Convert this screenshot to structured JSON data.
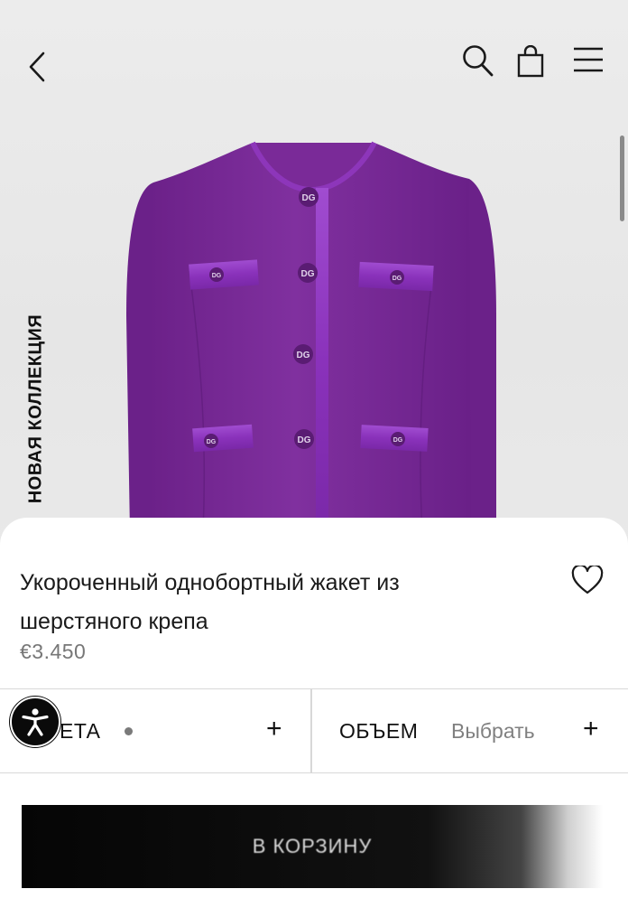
{
  "header": {
    "back_icon": "chevron-left-icon",
    "search_icon": "search-icon",
    "bag_icon": "shopping-bag-icon",
    "menu_icon": "hamburger-menu-icon"
  },
  "hero": {
    "collection_label": "НОВАЯ КОЛЛЕКЦИЯ",
    "image": "purple-jacket-photo",
    "button_monogram": "DG"
  },
  "product": {
    "title": "Укороченный однобортный жакет из шерстяного крепа",
    "price": "€3.450",
    "wishlist_icon": "heart-icon"
  },
  "options": {
    "color": {
      "label": "ЕТА",
      "add": "+"
    },
    "volume": {
      "label": "ОБЪЕМ",
      "value": "Выбрать",
      "add": "+"
    }
  },
  "accessibility": {
    "icon": "accessibility-icon"
  },
  "cart": {
    "label": "В КОРЗИНУ"
  },
  "colors": {
    "jacket": "#7e2a9e",
    "trim": "#8c34b8",
    "cart_button": "#0a0a0a",
    "price": "#777777"
  }
}
